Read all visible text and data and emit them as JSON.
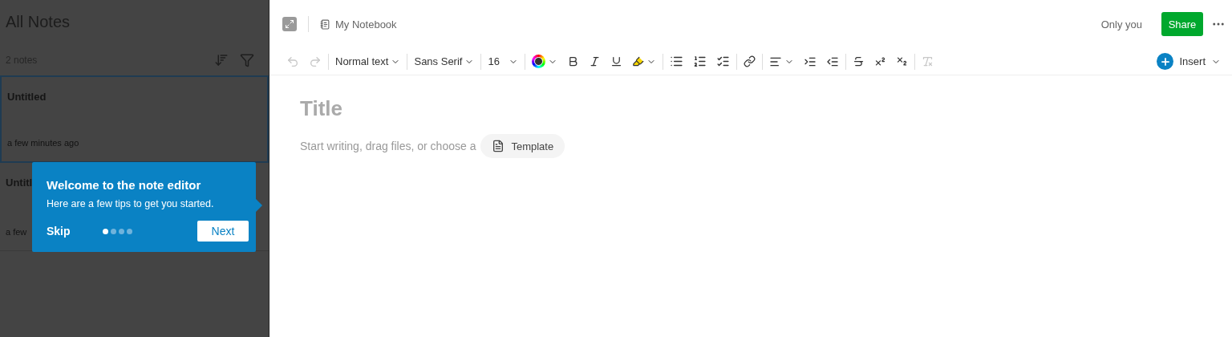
{
  "sidebar": {
    "title": "All Notes",
    "count": "2 notes",
    "notes": [
      {
        "title": "Untitled",
        "time": "a few minutes ago",
        "selected": true
      },
      {
        "title": "Untitl",
        "time": "a few",
        "selected": false
      }
    ]
  },
  "header": {
    "notebook": "My Notebook",
    "visibility": "Only you",
    "share": "Share"
  },
  "toolbar": {
    "undo": {
      "disabled": true
    },
    "redo": {
      "disabled": true
    },
    "style": "Normal text",
    "font": "Sans Serif",
    "size": "16",
    "clear_formatting": {
      "disabled": true
    },
    "insert": "Insert"
  },
  "editor": {
    "title_placeholder": "Title",
    "body_placeholder": "Start writing, drag files, or choose a",
    "template": "Template"
  },
  "tip": {
    "title": "Welcome to the note editor",
    "text": "Here are a few tips to get you started.",
    "skip": "Skip",
    "next": "Next",
    "steps": [
      {
        "selected": true
      },
      {
        "selected": false
      },
      {
        "selected": false
      },
      {
        "selected": false
      }
    ]
  }
}
